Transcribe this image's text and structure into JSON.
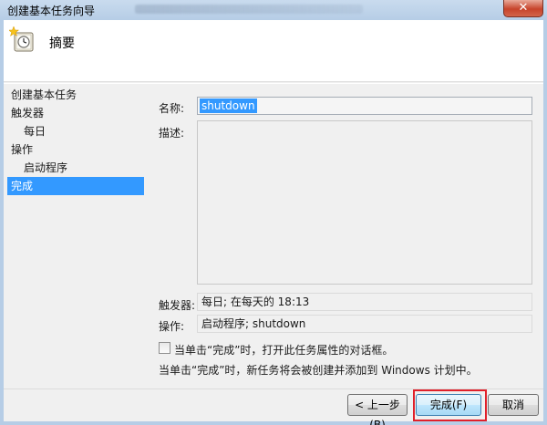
{
  "window": {
    "title": "创建基本任务向导",
    "close_symbol": "✕"
  },
  "header": {
    "title": "摘要",
    "icon": "task-clock-icon"
  },
  "nav": {
    "items": [
      {
        "label": "创建基本任务",
        "indent": false,
        "active": false
      },
      {
        "label": "触发器",
        "indent": false,
        "active": false
      },
      {
        "label": "每日",
        "indent": true,
        "active": false
      },
      {
        "label": "操作",
        "indent": false,
        "active": false
      },
      {
        "label": "启动程序",
        "indent": true,
        "active": false
      },
      {
        "label": "完成",
        "indent": false,
        "active": true
      }
    ]
  },
  "form": {
    "name_label": "名称:",
    "name_value": "shutdown",
    "desc_label": "描述:",
    "trigger_label": "触发器:",
    "trigger_value": "每日; 在每天的 18:13",
    "action_label": "操作:",
    "action_value": "启动程序; shutdown",
    "checkbox_label": "当单击“完成”时，打开此任务属性的对话框。",
    "info_text": "当单击“完成”时，新任务将会被创建并添加到 Windows 计划中。"
  },
  "buttons": {
    "back": "< 上一步(B)",
    "finish": "完成(F)",
    "cancel": "取消"
  },
  "colors": {
    "selection": "#3399ff",
    "highlight_box": "#e0202a"
  }
}
